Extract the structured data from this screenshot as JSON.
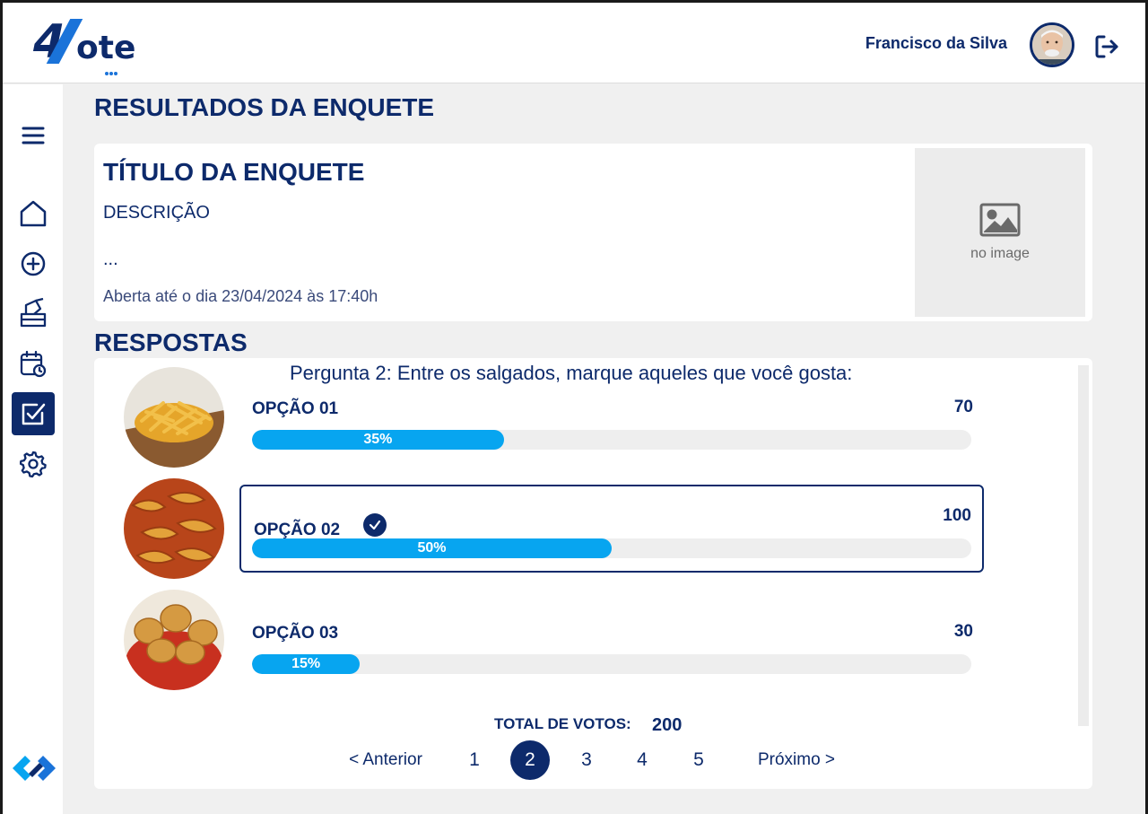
{
  "header": {
    "logo_text": "4Vote",
    "user_name": "Francisco da Silva",
    "logout_icon": "logout-icon"
  },
  "sidebar": {
    "items": [
      {
        "icon": "menu-icon"
      },
      {
        "icon": "home-icon"
      },
      {
        "icon": "add-circle-icon"
      },
      {
        "icon": "ballot-box-icon"
      },
      {
        "icon": "calendar-clock-icon"
      },
      {
        "icon": "checkbox-icon",
        "active": true
      },
      {
        "icon": "gear-icon"
      }
    ]
  },
  "page": {
    "title": "RESULTADOS DA ENQUETE"
  },
  "poll": {
    "title": "TÍTULO DA ENQUETE",
    "description": "DESCRIÇÃO",
    "ellipsis": "...",
    "deadline": "Aberta até o dia 23/04/2024 às 17:40h",
    "no_image": "no image"
  },
  "answers": {
    "title": "RESPOSTAS",
    "question": "Pergunta 2: Entre os salgados, marque aqueles que você gosta:",
    "options": [
      {
        "label": "OPÇÃO 01",
        "votes": "70",
        "percent_label": "35%",
        "percent": 35,
        "selected": false,
        "image": "french-fries"
      },
      {
        "label": "OPÇÃO 02",
        "votes": "100",
        "percent_label": "50%",
        "percent": 50,
        "selected": true,
        "image": "potato-wedges"
      },
      {
        "label": "OPÇÃO 03",
        "votes": "30",
        "percent_label": "15%",
        "percent": 15,
        "selected": false,
        "image": "coxinha"
      }
    ],
    "total_label": "TOTAL DE VOTOS:",
    "total_value": "200"
  },
  "pagination": {
    "prev": "< Anterior",
    "pages": [
      "1",
      "2",
      "3",
      "4",
      "5"
    ],
    "current": "2",
    "next": "Próximo >"
  },
  "colors": {
    "primary": "#0d2a6b",
    "accent": "#07a5f0",
    "background": "#f0f0f0"
  }
}
